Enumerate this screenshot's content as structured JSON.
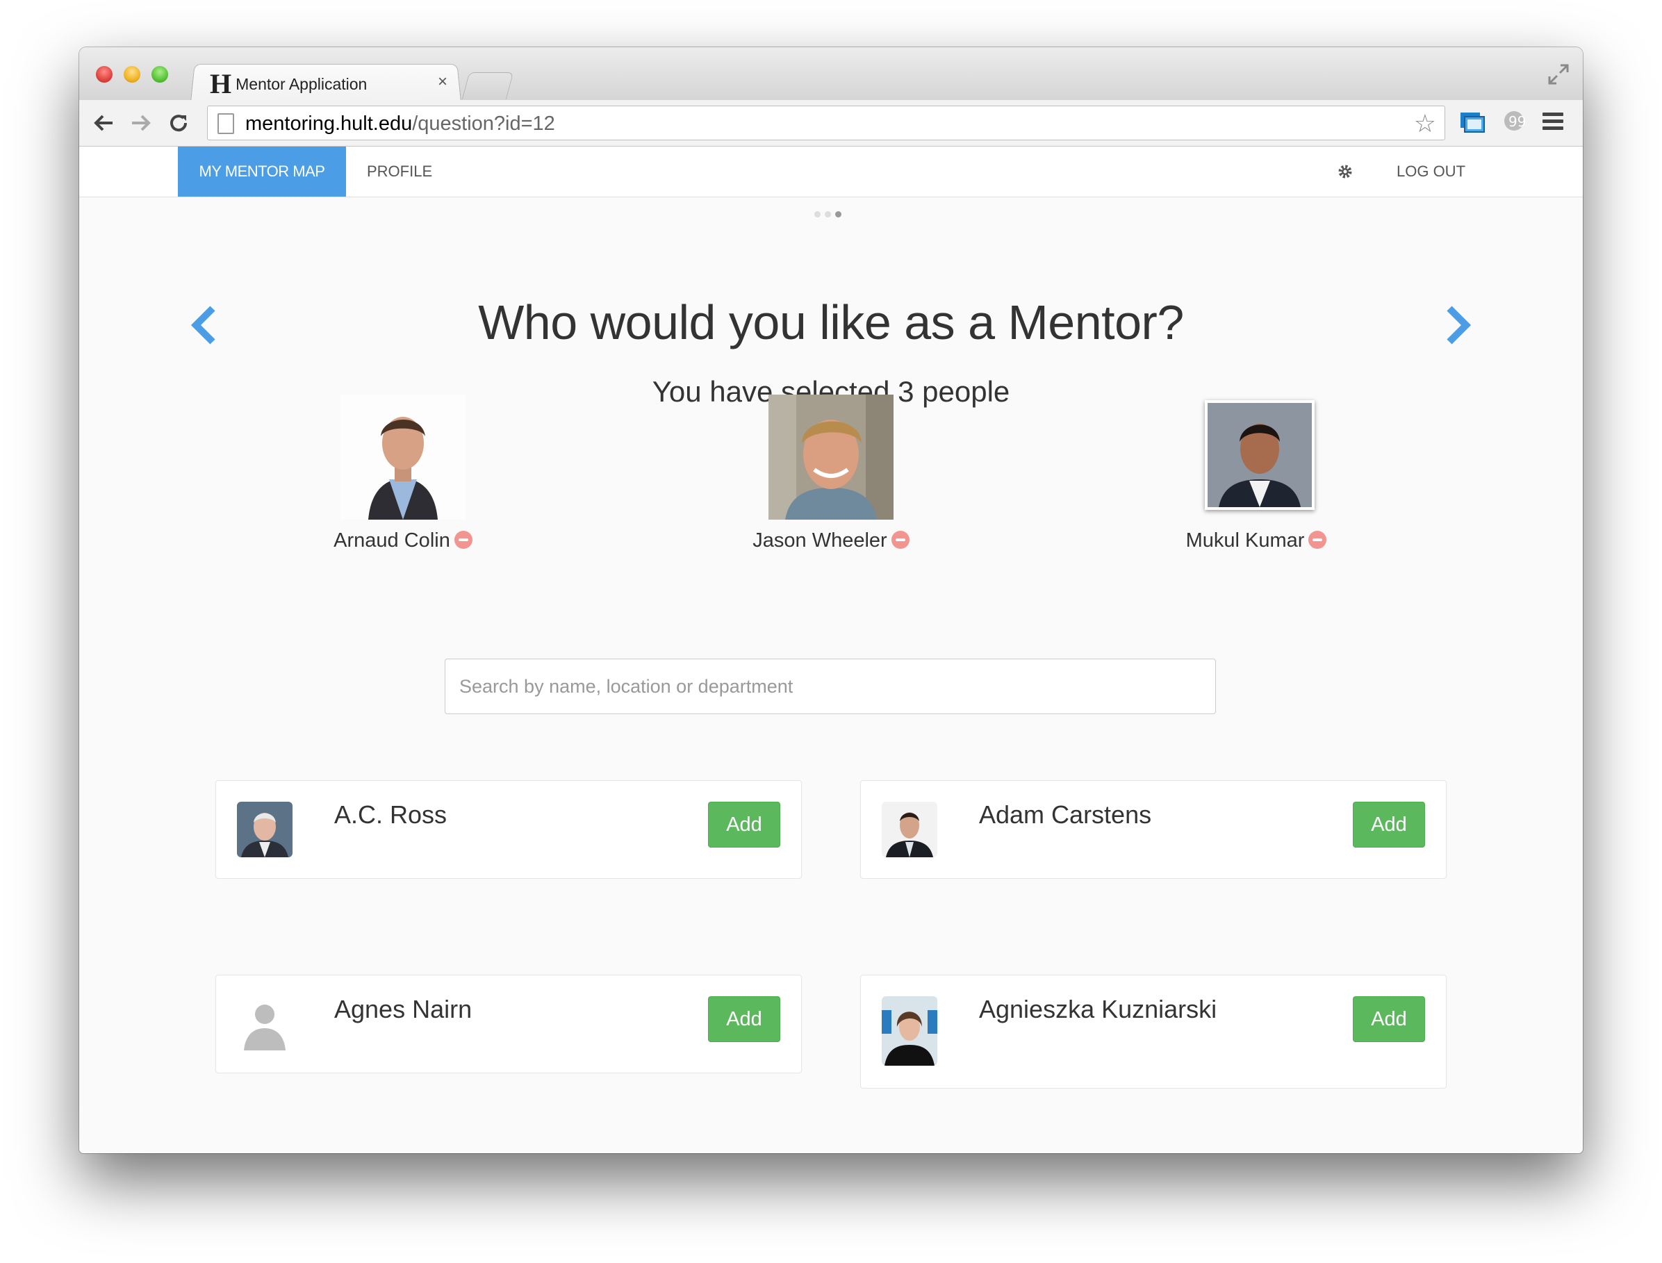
{
  "browser": {
    "tab_title": "Mentor Application",
    "tab_logo": "H",
    "tab_close": "×",
    "url_host": "mentoring.hult.edu",
    "url_path": "/question?id=12"
  },
  "nav": {
    "active": "MY MENTOR MAP",
    "profile": "PROFILE",
    "logout": "LOG OUT"
  },
  "page": {
    "heading": "Who would you like as a Mentor?",
    "subheading": "You have selected 3 people",
    "search_placeholder": "Search by name, location or department"
  },
  "selected": [
    {
      "name": "Arnaud Colin"
    },
    {
      "name": "Jason Wheeler"
    },
    {
      "name": "Mukul Kumar"
    }
  ],
  "results": [
    {
      "name": "A.C. Ross",
      "button": "Add"
    },
    {
      "name": "Adam Carstens",
      "button": "Add"
    },
    {
      "name": "Agnes Nairn",
      "button": "Add"
    },
    {
      "name": "Agnieszka Kuzniarski",
      "button": "Add"
    }
  ],
  "colors": {
    "accent": "#4b9ee6",
    "add": "#5cb85c",
    "remove": "#f2948f"
  }
}
